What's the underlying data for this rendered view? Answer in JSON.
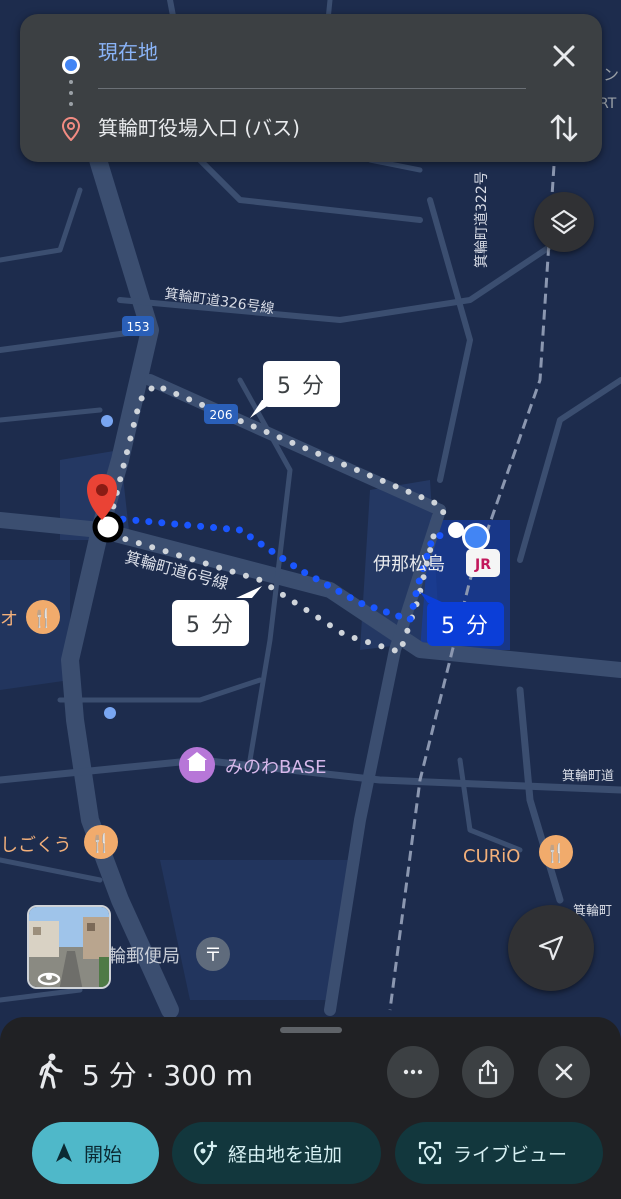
{
  "directions": {
    "origin": "現在地",
    "destination": "箕輪町役場入口 (バス)"
  },
  "map": {
    "roads": {
      "road_326": "箕輪町道326号線",
      "road_322": "箕輪町道322号",
      "road_6": "箕輪町道6号線",
      "road_right": "箕輪町道",
      "road_right2": "箕輪町"
    },
    "route_shields": {
      "r153": "153",
      "r206": "206"
    },
    "station_name": "伊那松島",
    "station_badge": "JR",
    "places": {
      "minowa_base": "みのわBASE",
      "curio": "CURiO",
      "left_restaurant_1": "オ",
      "left_restaurant_2": "しごくう",
      "post_office": "輪郵便局",
      "edge_text_top": "ン",
      "edge_text_top2": "RT"
    },
    "time_bubbles": {
      "upper_alt": "5 分",
      "lower_alt": "5 分",
      "selected": "5 分"
    }
  },
  "bottom_sheet": {
    "summary": "5 分 · 300 m",
    "start_label": "開始",
    "add_stop_label": "経由地を追加",
    "live_view_label": "ライブビュー"
  },
  "icons": {
    "close": "close-icon",
    "swap": "swap-icon",
    "layers": "layers-icon",
    "navigate": "navigation-arrow-icon",
    "walk": "walking-icon",
    "more": "more-horiz-icon",
    "share": "share-icon",
    "sheet_close": "close-icon"
  },
  "colors": {
    "map_bg": "#1d2c4d",
    "route_blue": "#1a56ff",
    "alt_route": "#cfd4da",
    "accent_teal": "#4fb8c9",
    "origin_blue": "#4285f4",
    "pin_red": "#ea4335"
  }
}
